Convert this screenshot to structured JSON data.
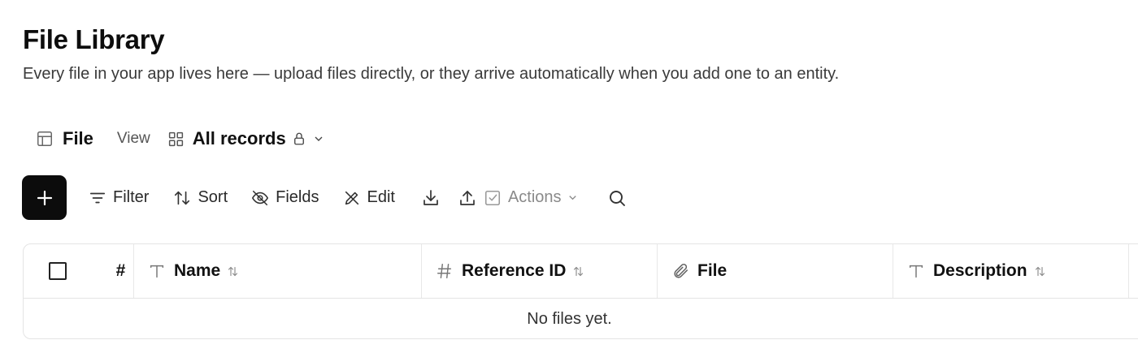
{
  "header": {
    "title": "File Library",
    "subtitle": "Every file in your app lives here — upload files directly, or they arrive automatically when you add one to an entity."
  },
  "viewbar": {
    "table_label": "File",
    "view_label": "View",
    "records_label": "All records"
  },
  "toolbar": {
    "filter_label": "Filter",
    "sort_label": "Sort",
    "fields_label": "Fields",
    "edit_label": "Edit",
    "actions_label": "Actions"
  },
  "table": {
    "columns": [
      {
        "label": "#",
        "icon": "none"
      },
      {
        "label": "Name",
        "icon": "text-type-icon"
      },
      {
        "label": "Reference ID",
        "icon": "hash-icon"
      },
      {
        "label": "File",
        "icon": "paperclip-icon"
      },
      {
        "label": "Description",
        "icon": "text-type-icon"
      }
    ],
    "empty_message": "No files yet."
  }
}
